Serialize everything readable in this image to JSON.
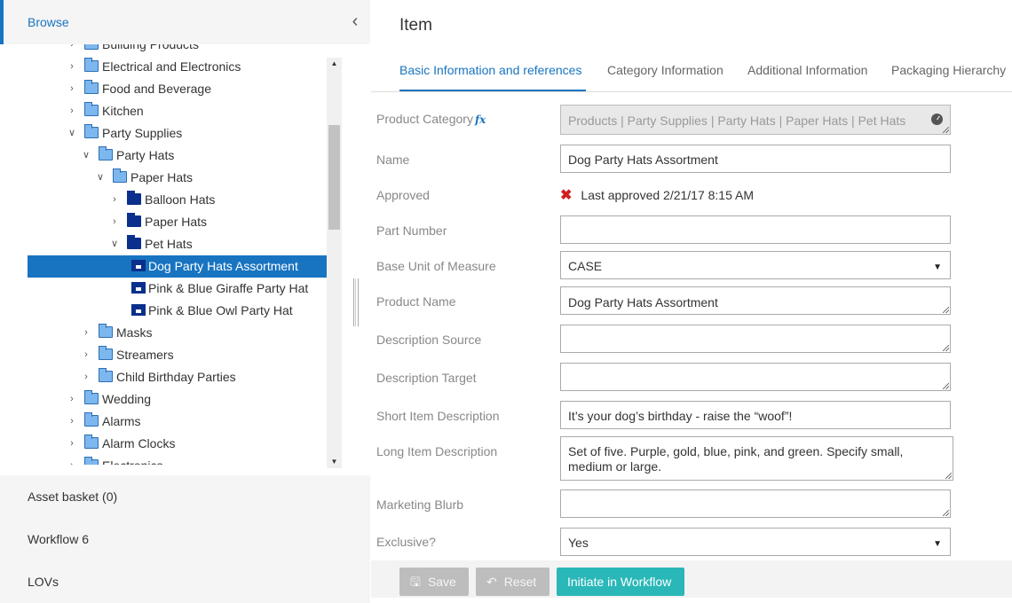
{
  "sidebar": {
    "title": "Browse",
    "collapse_icon": "chevron-left-icon",
    "tree": [
      {
        "label": "Building Products",
        "depth": 0,
        "arrow": "right",
        "icon": "folder"
      },
      {
        "label": "Electrical and Electronics",
        "depth": 0,
        "arrow": "right",
        "icon": "folder"
      },
      {
        "label": "Food and Beverage",
        "depth": 0,
        "arrow": "right",
        "icon": "folder"
      },
      {
        "label": "Kitchen",
        "depth": 0,
        "arrow": "right",
        "icon": "folder"
      },
      {
        "label": "Party Supplies",
        "depth": 0,
        "arrow": "down",
        "icon": "folder"
      },
      {
        "label": "Party Hats",
        "depth": 1,
        "arrow": "down",
        "icon": "folder"
      },
      {
        "label": "Paper Hats",
        "depth": 2,
        "arrow": "down",
        "icon": "folder"
      },
      {
        "label": "Balloon Hats",
        "depth": 3,
        "arrow": "right",
        "icon": "folder-dark"
      },
      {
        "label": "Paper Hats",
        "depth": 3,
        "arrow": "right",
        "icon": "folder-dark"
      },
      {
        "label": "Pet Hats",
        "depth": 3,
        "arrow": "down",
        "icon": "folder-dark"
      },
      {
        "label": "Dog Party Hats Assortment",
        "depth": 4,
        "arrow": "",
        "icon": "product",
        "selected": true
      },
      {
        "label": "Pink & Blue Giraffe Party Hat",
        "depth": 4,
        "arrow": "",
        "icon": "product"
      },
      {
        "label": "Pink & Blue Owl Party Hat",
        "depth": 4,
        "arrow": "",
        "icon": "product"
      },
      {
        "label": "Masks",
        "depth": 1,
        "arrow": "right",
        "icon": "folder"
      },
      {
        "label": "Streamers",
        "depth": 1,
        "arrow": "right",
        "icon": "folder"
      },
      {
        "label": "Child Birthday Parties",
        "depth": 1,
        "arrow": "right",
        "icon": "folder"
      },
      {
        "label": "Wedding",
        "depth": 0,
        "arrow": "right",
        "icon": "folder"
      },
      {
        "label": "Alarms",
        "depth": 0,
        "arrow": "right",
        "icon": "folder"
      },
      {
        "label": "Alarm Clocks",
        "depth": 0,
        "arrow": "right",
        "icon": "folder"
      },
      {
        "label": "Electronics",
        "depth": 0,
        "arrow": "right",
        "icon": "folder"
      }
    ],
    "accordions": [
      "Asset basket (0)",
      "Workflow 6",
      "LOVs"
    ]
  },
  "main": {
    "title": "Item",
    "tabs": [
      {
        "label": "Basic Information and references",
        "active": true
      },
      {
        "label": "Category Information",
        "active": false
      },
      {
        "label": "Additional Information",
        "active": false
      },
      {
        "label": "Packaging Hierarchy",
        "active": false
      }
    ],
    "fields": {
      "product_category": {
        "label": "Product Category",
        "fx": "fx",
        "value": "Products | Party Supplies | Party Hats | Paper Hats | Pet Hats"
      },
      "name": {
        "label": "Name",
        "value": "Dog Party Hats Assortment"
      },
      "approved": {
        "label": "Approved",
        "value": "Last approved 2/21/17 8:15 AM",
        "status_icon": "x-icon"
      },
      "part_number": {
        "label": "Part Number",
        "value": ""
      },
      "base_uom": {
        "label": "Base Unit of Measure",
        "value": "CASE"
      },
      "product_name": {
        "label": "Product Name",
        "value": "Dog Party Hats Assortment"
      },
      "description_source": {
        "label": "Description Source",
        "value": ""
      },
      "description_target": {
        "label": "Description Target",
        "value": ""
      },
      "short_desc": {
        "label": "Short Item Description",
        "value": "It’s your dog’s birthday - raise the “woof”!"
      },
      "long_desc": {
        "label": "Long Item Description",
        "value": "Set of five. Purple, gold, blue, pink, and green. Specify small, medium or large."
      },
      "marketing_blurb": {
        "label": "Marketing Blurb",
        "value": ""
      },
      "exclusive": {
        "label": "Exclusive?",
        "value": "Yes"
      }
    },
    "buttons": {
      "save": "Save",
      "reset": "Reset",
      "initiate": "Initiate in Workflow"
    }
  },
  "colors": {
    "accent": "#1874c1",
    "primary_button": "#2ab7b8",
    "error": "#d21f1f"
  }
}
